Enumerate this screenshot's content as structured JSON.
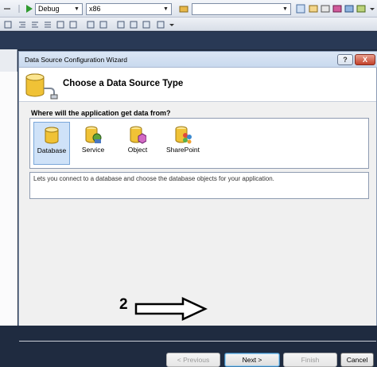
{
  "toolbar": {
    "config_combo": "Debug",
    "platform_combo": "x86",
    "search_combo": ""
  },
  "dialog": {
    "title": "Data Source Configuration Wizard",
    "help_label": "?",
    "close_label": "X",
    "heading": "Choose a Data Source Type",
    "question": "Where will the application get data from?",
    "items": [
      {
        "label": "Database",
        "selected": true
      },
      {
        "label": "Service",
        "selected": false
      },
      {
        "label": "Object",
        "selected": false
      },
      {
        "label": "SharePoint",
        "selected": false
      }
    ],
    "description": "Lets you connect to a database and choose the database objects for your application.",
    "buttons": {
      "previous": "< Previous",
      "next": "Next >",
      "finish": "Finish",
      "cancel": "Cancel"
    }
  },
  "annotation": {
    "step_number": "2"
  },
  "colors": {
    "accent": "#3c7fb1",
    "selection": "#cfe2f8",
    "background_ide": "#293955"
  }
}
